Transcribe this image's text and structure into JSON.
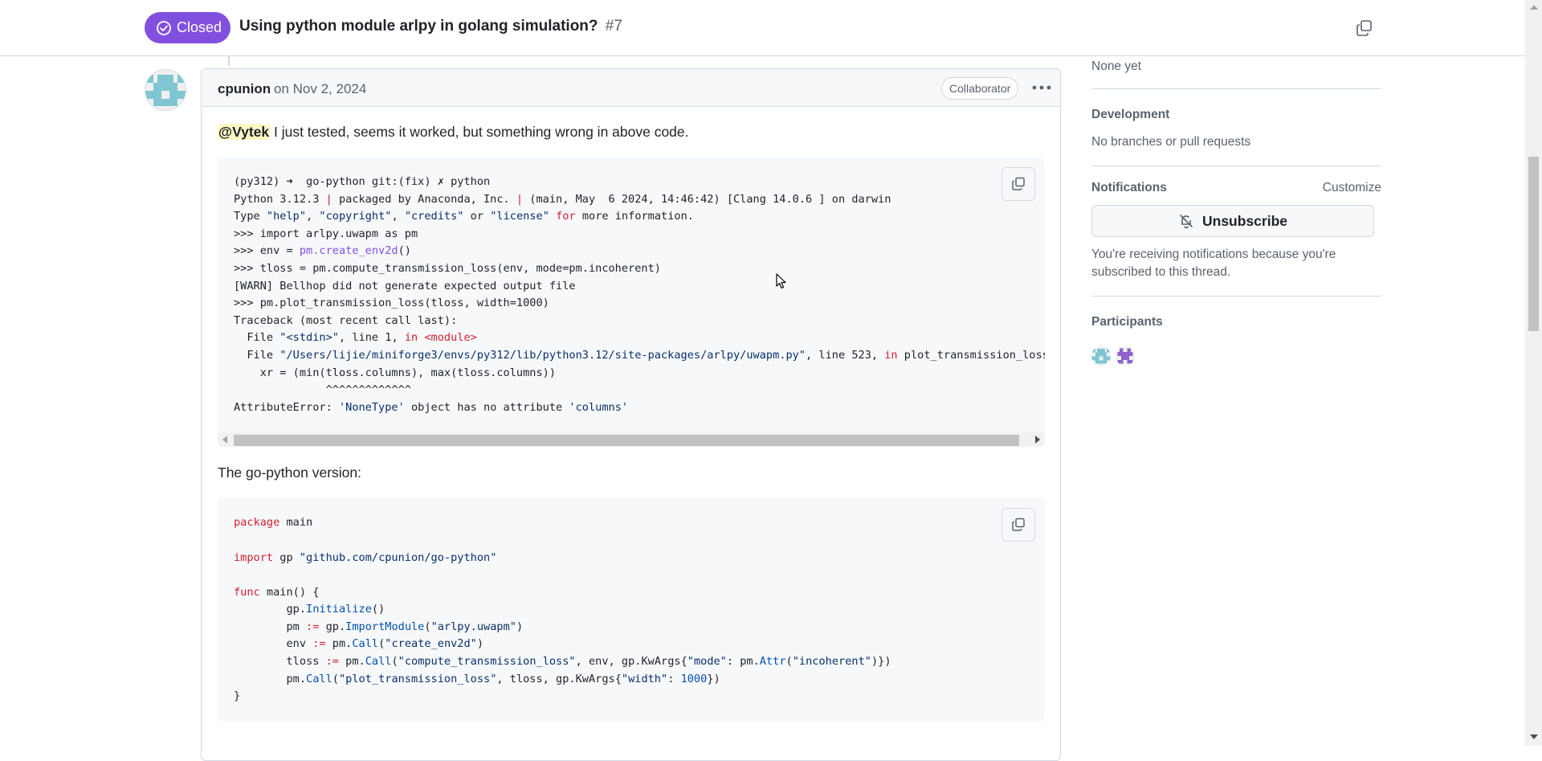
{
  "header": {
    "state_label": "Closed",
    "title": "Using python module arlpy in golang simulation?",
    "number": "#7"
  },
  "comment": {
    "author": "cpunion",
    "date": "on Nov 2, 2024",
    "role": "Collaborator",
    "mention": "@Vytek",
    "text": " I just tested, seems it worked, but something wrong in above code.",
    "second_text": "The go-python version:"
  },
  "sidebar": {
    "milestone_value": "None yet",
    "development_heading": "Development",
    "development_value": "No branches or pull requests",
    "notifications_heading": "Notifications",
    "customize_label": "Customize",
    "unsubscribe_label": "Unsubscribe",
    "notification_reason": "You're receiving notifications because you're subscribed to this thread.",
    "participants_heading": "Participants"
  },
  "colors": {
    "closed_badge": "#8250df",
    "mention_bg": "#fff8c5"
  }
}
